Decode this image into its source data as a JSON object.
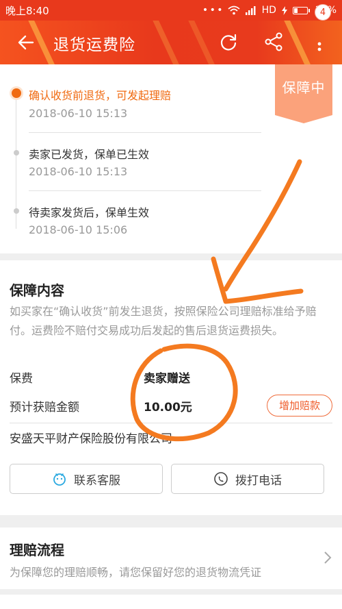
{
  "status_bar": {
    "time": "晚上8:40",
    "dots": "• • •",
    "network": "HD",
    "battery": "26%"
  },
  "header": {
    "title": "退货运费险",
    "badge_count": "4"
  },
  "status_tag": "保障中",
  "timeline": [
    {
      "text": "确认收货前退货，可发起理赔",
      "time": "2018-06-10 15:13",
      "active": true
    },
    {
      "text": "卖家已发货，保单已生效",
      "time": "2018-06-10 15:13",
      "active": false
    },
    {
      "text": "待卖家发货后，保单生效",
      "time": "2018-06-10 15:06",
      "active": false
    }
  ],
  "coverage": {
    "title": "保障内容",
    "description": "如买家在“确认收货”前发生退货，按照保险公司理赔标准给予赔付。运费险不赔付交易成功后发起的售后退货运费损失。",
    "premium_label": "保费",
    "premium_value": "卖家赠送",
    "payout_label": "预计获赔金额",
    "payout_value": "10.00元",
    "increase_button": "增加赔款",
    "insurer": "安盛天平财产保险股份有限公司",
    "contact_service": "联系客服",
    "call_phone": "拨打电话"
  },
  "claim_flow": {
    "title": "理赔流程",
    "description": "为保障您的理赔顺畅，请您保留好您的退货物流凭证"
  },
  "colors": {
    "brand_red": "#e8391c",
    "accent_orange": "#f06a10",
    "tag_bg": "#fba27b",
    "annotation": "#f47a20"
  }
}
